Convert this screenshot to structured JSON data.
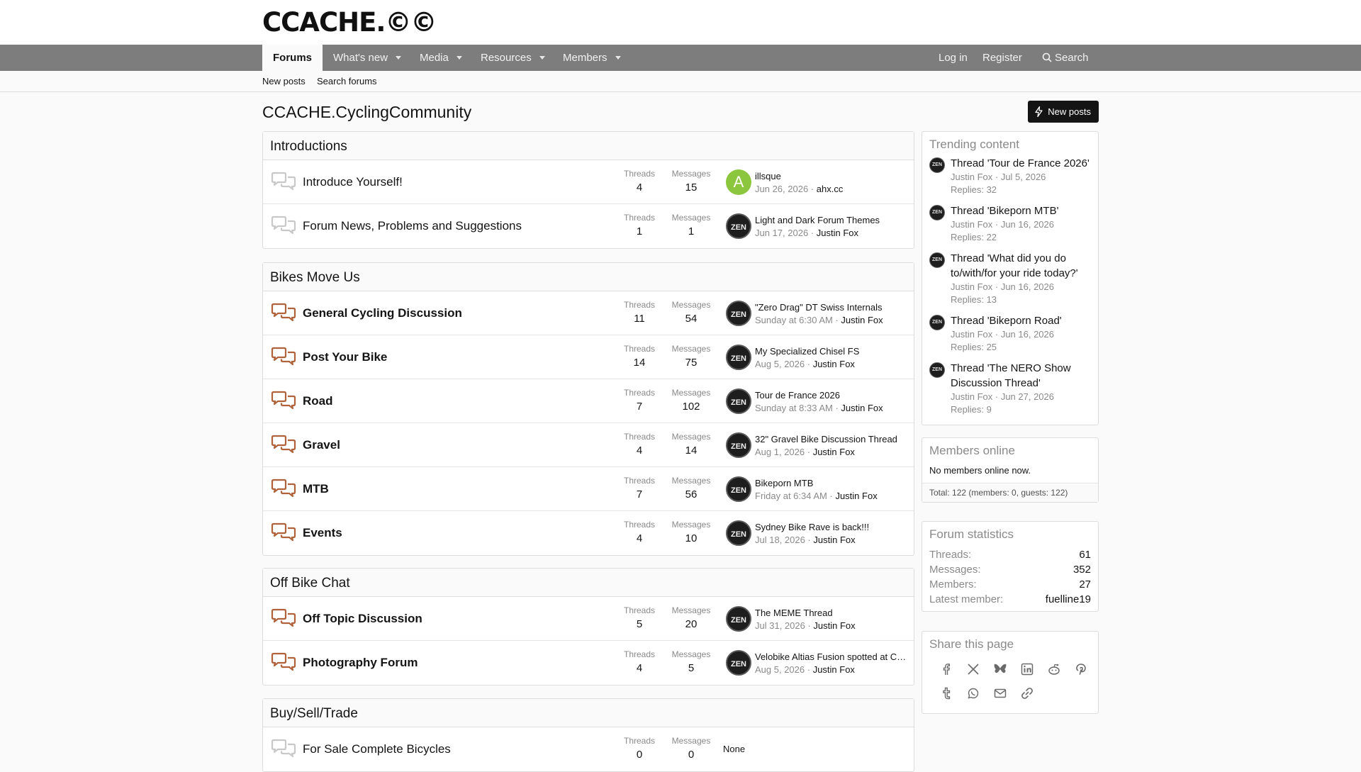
{
  "site": {
    "logo": "CCACHE.©©"
  },
  "nav": {
    "tabs": [
      {
        "label": "Forums"
      },
      {
        "label": "What's new"
      },
      {
        "label": "Media"
      },
      {
        "label": "Resources"
      },
      {
        "label": "Members"
      }
    ],
    "login": "Log in",
    "register": "Register",
    "search": "Search"
  },
  "subnav": {
    "new_posts": "New posts",
    "search_forums": "Search forums"
  },
  "page": {
    "title": "CCACHE.CyclingCommunity",
    "new_posts_button": "New posts"
  },
  "labels": {
    "threads": "Threads",
    "messages": "Messages"
  },
  "categories": [
    {
      "title": "Introductions",
      "nodes": [
        {
          "title": "Introduce Yourself!",
          "threads": "4",
          "messages": "15",
          "last_title": "illsque",
          "last_date": "Jun 26, 2026",
          "last_user": "ahx.cc",
          "avatar": "A"
        },
        {
          "title": "Forum News, Problems and Suggestions",
          "threads": "1",
          "messages": "1",
          "last_title": "Light and Dark Forum Themes",
          "last_date": "Jun 17, 2026",
          "last_user": "Justin Fox",
          "avatar": "ZEN"
        }
      ]
    },
    {
      "title": "Bikes Move Us",
      "nodes": [
        {
          "title": "General Cycling Discussion",
          "threads": "11",
          "messages": "54",
          "last_title": "\"Zero Drag\" DT Swiss Internals",
          "last_date": "Sunday at 6:30 AM",
          "last_user": "Justin Fox",
          "avatar": "ZEN"
        },
        {
          "title": "Post Your Bike",
          "threads": "14",
          "messages": "75",
          "last_title": "My Specialized Chisel FS",
          "last_date": "Aug 5, 2026",
          "last_user": "Justin Fox",
          "avatar": "ZEN"
        },
        {
          "title": "Road",
          "threads": "7",
          "messages": "102",
          "last_title": "Tour de France 2026",
          "last_date": "Sunday at 8:33 AM",
          "last_user": "Justin Fox",
          "avatar": "ZEN"
        },
        {
          "title": "Gravel",
          "threads": "4",
          "messages": "14",
          "last_title": "32\" Gravel Bike Discussion Thread",
          "last_date": "Aug 1, 2026",
          "last_user": "Justin Fox",
          "avatar": "ZEN"
        },
        {
          "title": "MTB",
          "threads": "7",
          "messages": "56",
          "last_title": "Bikeporn MTB",
          "last_date": "Friday at 6:34 AM",
          "last_user": "Justin Fox",
          "avatar": "ZEN"
        },
        {
          "title": "Events",
          "threads": "4",
          "messages": "10",
          "last_title": "Sydney Bike Rave is back!!!",
          "last_date": "Jul 18, 2026",
          "last_user": "Justin Fox",
          "avatar": "ZEN"
        }
      ]
    },
    {
      "title": "Off Bike Chat",
      "nodes": [
        {
          "title": "Off Topic Discussion",
          "threads": "5",
          "messages": "20",
          "last_title": "The MEME Thread",
          "last_date": "Jul 31, 2026",
          "last_user": "Justin Fox",
          "avatar": "ZEN"
        },
        {
          "title": "Photography Forum",
          "threads": "4",
          "messages": "5",
          "last_title": "Velobike Altias Fusion spotted at C…",
          "last_date": "Aug 5, 2026",
          "last_user": "Justin Fox",
          "avatar": "ZEN"
        }
      ]
    },
    {
      "title": "Buy/Sell/Trade",
      "nodes": [
        {
          "title": "For Sale Complete Bicycles",
          "threads": "0",
          "messages": "0",
          "last_none": "None"
        }
      ]
    }
  ],
  "trending": {
    "title": "Trending content",
    "items": [
      {
        "title": "Thread 'Tour de France 2026'",
        "user": "Justin Fox",
        "date": "Jul 5, 2026",
        "replies": "Replies: 32"
      },
      {
        "title": "Thread 'Bikeporn MTB'",
        "user": "Justin Fox",
        "date": "Jun 16, 2026",
        "replies": "Replies: 22"
      },
      {
        "title": "Thread 'What did you do to/with/for your ride today?'",
        "user": "Justin Fox",
        "date": "Jun 16, 2026",
        "replies": "Replies: 13"
      },
      {
        "title": "Thread 'Bikeporn Road'",
        "user": "Justin Fox",
        "date": "Jun 16, 2026",
        "replies": "Replies: 25"
      },
      {
        "title": "Thread 'The NERO Show Discussion Thread'",
        "user": "Justin Fox",
        "date": "Jun 27, 2026",
        "replies": "Replies: 9"
      }
    ]
  },
  "members_online": {
    "title": "Members online",
    "body": "No members online now.",
    "total": "Total: 122 (members: 0, guests: 122)"
  },
  "forum_stats": {
    "title": "Forum statistics",
    "rows": [
      {
        "k": "Threads:",
        "v": "61"
      },
      {
        "k": "Messages:",
        "v": "352"
      },
      {
        "k": "Members:",
        "v": "27"
      },
      {
        "k": "Latest member:",
        "v": "fuelline19"
      }
    ]
  },
  "share": {
    "title": "Share this page",
    "icons": [
      "facebook-icon",
      "x-icon",
      "bluesky-icon",
      "linkedin-icon",
      "reddit-icon",
      "pinterest-icon",
      "tumblr-icon",
      "whatsapp-icon",
      "email-icon",
      "link-icon"
    ]
  },
  "colors": {
    "nav_bg": "#7d7d7d",
    "accent_icon": "#b0623a",
    "read_icon": "#c8c8c8",
    "button_bg": "#141414"
  }
}
